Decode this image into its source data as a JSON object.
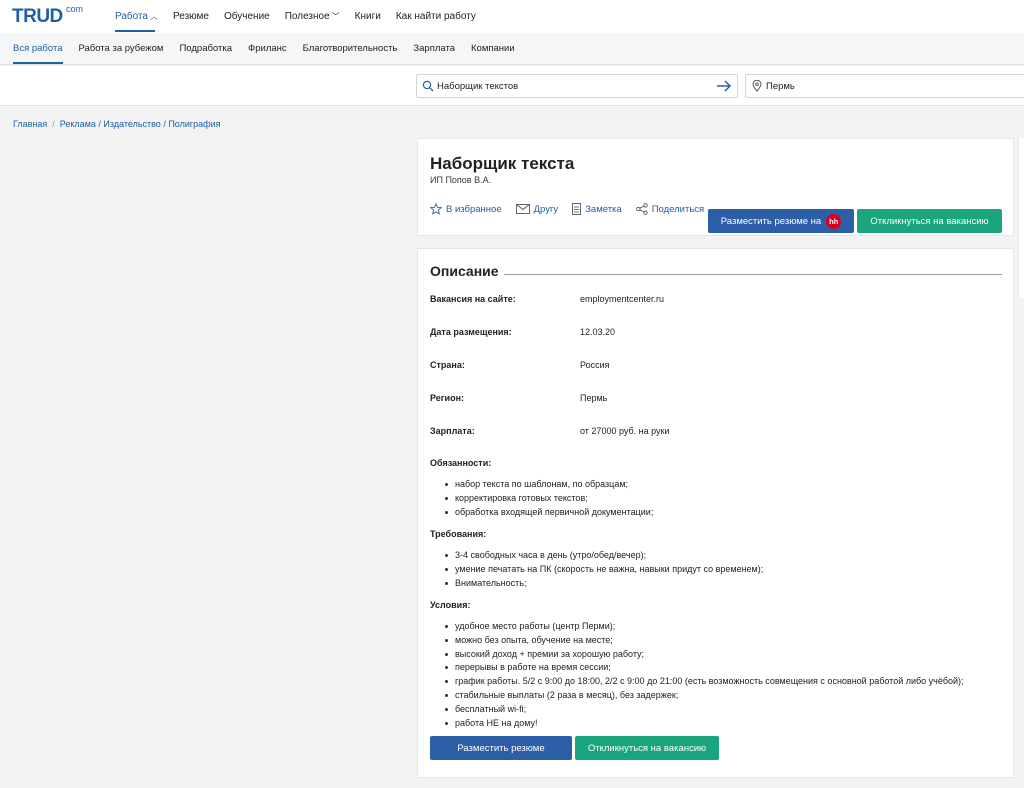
{
  "header": {
    "logo": "TRUD",
    "logo_sup": "com",
    "nav": [
      {
        "label": "Работа",
        "chevron": "chevron-up-icon"
      },
      {
        "label": "Резюме"
      },
      {
        "label": "Обучение"
      },
      {
        "label": "Полезное",
        "chevron": "chevron-down-icon"
      },
      {
        "label": "Книги"
      },
      {
        "label": "Как найти работу"
      }
    ]
  },
  "subnav": [
    "Вся работа",
    "Работа за рубежом",
    "Подработка",
    "Фриланс",
    "Благотворительность",
    "Зарплата",
    "Компании"
  ],
  "search": {
    "query": "Наборщик текстов",
    "location": "Пермь"
  },
  "breadcrumb": [
    "Главная",
    "Реклама / Издательство / Полиграфия"
  ],
  "job": {
    "title": "Наборщик текста",
    "company": "ИП Попов В.А.",
    "actions": [
      "В избранное",
      "Другу",
      "Заметка",
      "Поделиться"
    ],
    "post_resume_hh": "Разместить резюме на",
    "hh_badge": "hh",
    "apply": "Откликнуться на вакансию"
  },
  "description": {
    "title": "Описание",
    "fields": [
      {
        "label": "Вакансия на сайте:",
        "value": "employmentcenter.ru"
      },
      {
        "label": "Дата размещения:",
        "value": "12.03.20"
      },
      {
        "label": "Страна:",
        "value": "Россия"
      },
      {
        "label": "Регион:",
        "value": "Пермь"
      },
      {
        "label": "Зарплата:",
        "value": "от 27000 руб. на руки"
      }
    ],
    "duties_title": "Обязанности:",
    "duties": [
      "набор текста по шаблонам, по образцам;",
      "корректировка готовых текстов;",
      "обработка входящей первичной документации;"
    ],
    "requirements_title": "Требования:",
    "requirements": [
      "3-4 свободных часа в день (утро/обед/вечер);",
      "умение печатать на ПК (скорость не важна, навыки придут со временем);",
      "Внимательность;"
    ],
    "conditions_title": "Условия:",
    "conditions": [
      "удобное место работы (центр Перми);",
      "можно без опыта, обучение на месте;",
      "высокий доход + премии за хорошую работу;",
      "перерывы в работе на время сессии;",
      "график работы. 5/2 с 9:00 до 18:00, 2/2 с 9:00 до 21:00 (есть возможность совмещения с основной работой либо учёбой);",
      "стабильные выплаты (2 раза в месяц), без задержек;",
      "бесплатный wi-fi;",
      "работа НЕ на дому!"
    ],
    "post_resume": "Разместить резюме",
    "apply": "Откликнуться на вакансию"
  }
}
